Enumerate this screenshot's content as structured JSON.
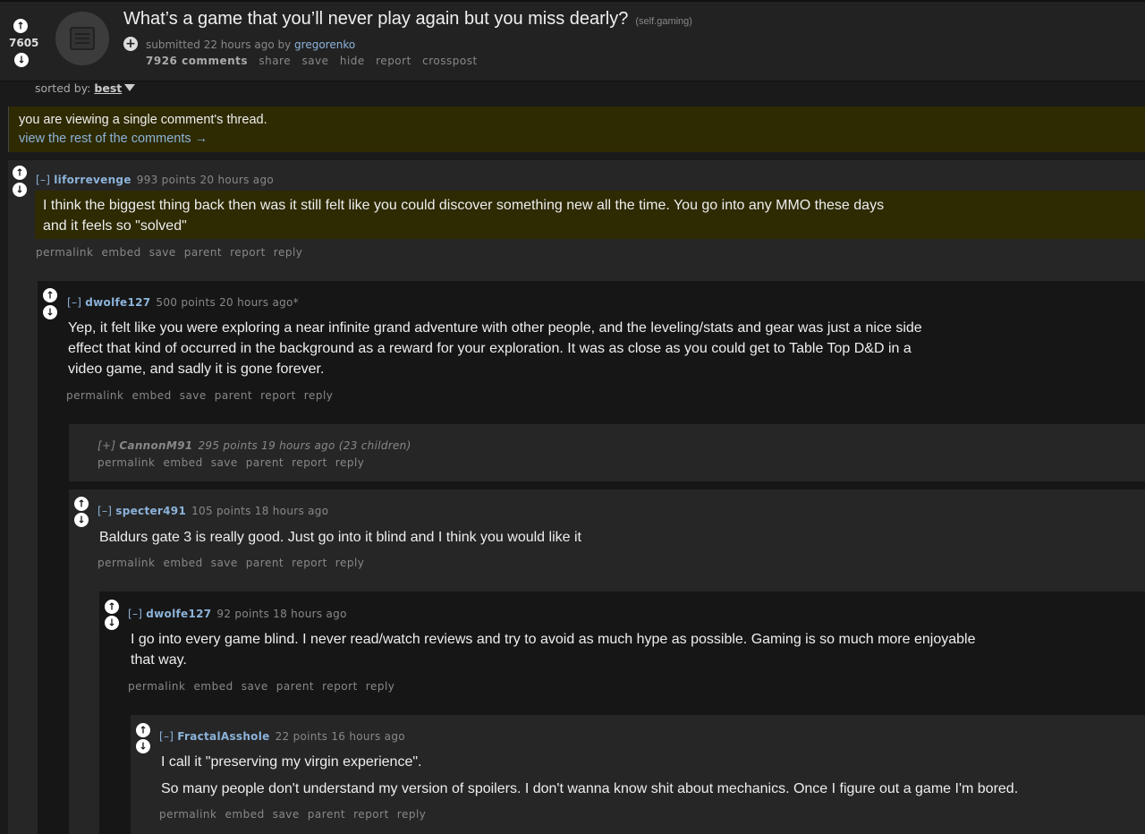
{
  "post": {
    "score": "7605",
    "title": "What’s a game that you’ll never play again but you miss dearly?",
    "domain": "(self.gaming)",
    "tagline_prefix": "submitted 22 hours ago by",
    "author": "gregorenko",
    "comments_label": "7926 comments",
    "buttons": [
      "share",
      "save",
      "hide",
      "report",
      "crosspost"
    ]
  },
  "sort": {
    "label": "sorted by:",
    "value": "best"
  },
  "notice": {
    "line1": "you are viewing a single comment's thread.",
    "line2": "view the rest of the comments →"
  },
  "comment_buttons": [
    "permalink",
    "embed",
    "save",
    "parent",
    "report",
    "reply"
  ],
  "comments": [
    {
      "toggle": "[–]",
      "author": "liforrevenge",
      "meta": "993 points 20 hours ago",
      "lines": [
        "I think the biggest thing back then was it still felt like you could discover something new all the time. You go into any MMO these days",
        "and it feels so \"solved\""
      ]
    },
    {
      "toggle": "[–]",
      "author": "dwolfe127",
      "meta": "500 points 20 hours ago*",
      "lines": [
        "Yep, it felt like you were exploring a near infinite grand adventure with other people, and the leveling/stats and gear was just a nice side",
        "effect that kind of occurred in the background as a reward for your exploration. It was as close as you could get to Table Top D&D in a",
        "video game, and sadly it is gone forever."
      ]
    },
    {
      "toggle": "[+]",
      "author": "CannonM91",
      "meta": "295 points 19 hours ago (23 children)",
      "lines": []
    },
    {
      "toggle": "[–]",
      "author": "specter491",
      "meta": "105 points 18 hours ago",
      "lines": [
        "Baldurs gate 3 is really good. Just go into it blind and I think you would like it"
      ]
    },
    {
      "toggle": "[–]",
      "author": "dwolfe127",
      "meta": "92 points 18 hours ago",
      "lines": [
        "I go into every game blind. I never read/watch reviews and try to avoid as much hype as possible. Gaming is so much more enjoyable",
        "that way."
      ]
    },
    {
      "toggle": "[–]",
      "author": "FractalAsshole",
      "meta": "22 points 16 hours ago",
      "lines": [
        "I call it \"preserving my virgin experience\".",
        "So many people don't understand my version of spoilers. I don't wanna know shit about mechanics. Once I figure out a game I'm bored."
      ]
    }
  ],
  "colors": {
    "link": "#8cb3d9",
    "highlight": "#2e2a02",
    "background": "#1a1a1b"
  },
  "icons": {
    "upvote": "arrow-up-circle",
    "downvote": "arrow-down-circle",
    "thumbnail": "self-post-icon",
    "expando": "plus-circle"
  }
}
